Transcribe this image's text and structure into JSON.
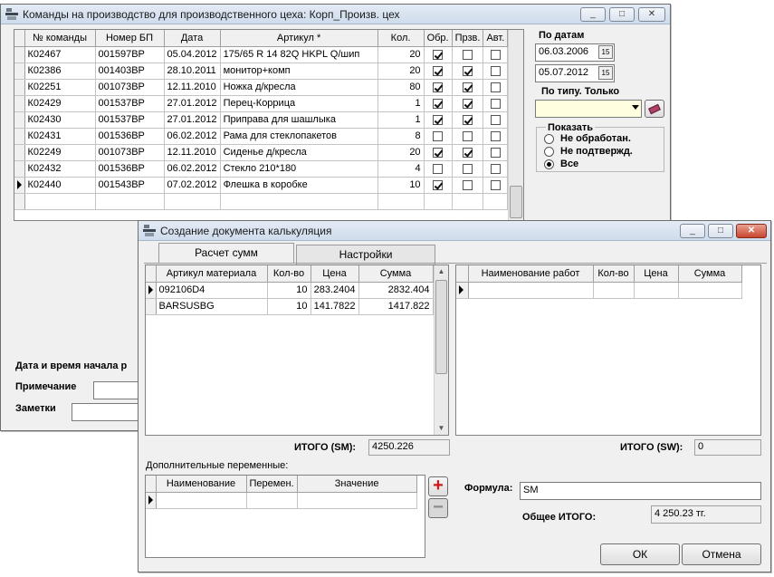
{
  "main": {
    "title": "Команды на производство для производственного цеха: Корп_Произв. цех",
    "window_buttons": [
      "_",
      "□",
      "✕"
    ],
    "columns": [
      "№ команды",
      "Номер БП",
      "Дата",
      "Артикул *",
      "Кол.",
      "Обр.",
      "Прзв.",
      "Авт."
    ],
    "rows": [
      {
        "cmd": "К02467",
        "bp": "001597ВР",
        "date": "05.04.2012",
        "article": "175/65 R 14 82Q HKPL Q/шип",
        "qty": "20",
        "obr": true,
        "prz": false,
        "avt": false
      },
      {
        "cmd": "К02386",
        "bp": "001403ВР",
        "date": "28.10.2011",
        "article": "монитор+комп",
        "qty": "20",
        "obr": true,
        "prz": true,
        "avt": false
      },
      {
        "cmd": "К02251",
        "bp": "001073ВР",
        "date": "12.11.2010",
        "article": "Ножка д/кресла",
        "qty": "80",
        "obr": true,
        "prz": true,
        "avt": false
      },
      {
        "cmd": "К02429",
        "bp": "001537ВР",
        "date": "27.01.2012",
        "article": "Перец-Коррица",
        "qty": "1",
        "obr": true,
        "prz": true,
        "avt": false
      },
      {
        "cmd": "К02430",
        "bp": "001537ВР",
        "date": "27.01.2012",
        "article": "Приправа для шашлыка",
        "qty": "1",
        "obr": true,
        "prz": true,
        "avt": false
      },
      {
        "cmd": "К02431",
        "bp": "001536ВР",
        "date": "06.02.2012",
        "article": "Рама для стеклопакетов",
        "qty": "8",
        "obr": false,
        "prz": false,
        "avt": false
      },
      {
        "cmd": "К02249",
        "bp": "001073ВР",
        "date": "12.11.2010",
        "article": "Сиденье д/кресла",
        "qty": "20",
        "obr": true,
        "prz": true,
        "avt": false
      },
      {
        "cmd": "К02432",
        "bp": "001536ВР",
        "date": "06.02.2012",
        "article": "Стекло 210*180",
        "qty": "4",
        "obr": false,
        "prz": false,
        "avt": false
      },
      {
        "cmd": "К02440",
        "bp": "001543ВР",
        "date": "07.02.2012",
        "article": "Флешка в коробке",
        "qty": "10",
        "obr": true,
        "prz": false,
        "avt": false
      }
    ],
    "current_row": 8,
    "filter": {
      "by_dates_label": "По датам",
      "date_from": "06.03.2006",
      "date_to": "05.07.2012",
      "by_type_label": "По типу. Только",
      "type_value": "",
      "show_label": "Показать",
      "options": [
        "Не обработан.",
        "Не подтвержд.",
        "Все"
      ],
      "selected_option": 2
    },
    "bottom": {
      "datetime_label": "Дата и время начала р",
      "note_label": "Примечание",
      "notes_label": "Заметки"
    }
  },
  "dialog": {
    "title": "Создание документа калькуляция",
    "window_buttons": [
      "_",
      "□",
      "✕"
    ],
    "tabs": [
      "Расчет сумм",
      "Настройки"
    ],
    "active_tab": 0,
    "materials": {
      "columns": [
        "Артикул материала",
        "Кол-во",
        "Цена",
        "Сумма"
      ],
      "rows": [
        {
          "article": "092106D4",
          "qty": "10",
          "price": "283.2404",
          "sum": "2832.404"
        },
        {
          "article": "BARSUSBG",
          "qty": "10",
          "price": "141.7822",
          "sum": "1417.822"
        }
      ],
      "total_label": "ИТОГО (SM):",
      "total_value": "4250.226"
    },
    "works": {
      "columns": [
        "Наименование работ",
        "Кол-во",
        "Цена",
        "Сумма"
      ],
      "total_label": "ИТОГО (SW):",
      "total_value": "0"
    },
    "extra_vars": {
      "label": "Дополнительные переменные:",
      "columns": [
        "Наименование",
        "Перемен.",
        "Значение"
      ],
      "add_label": "+",
      "remove_label": "−"
    },
    "formula_label": "Формула:",
    "formula_value": "SM",
    "grand_total_label": "Общее ИТОГО:",
    "grand_total_value": "4 250.23 тг.",
    "ok_label": "ОК",
    "cancel_label": "Отмена"
  }
}
